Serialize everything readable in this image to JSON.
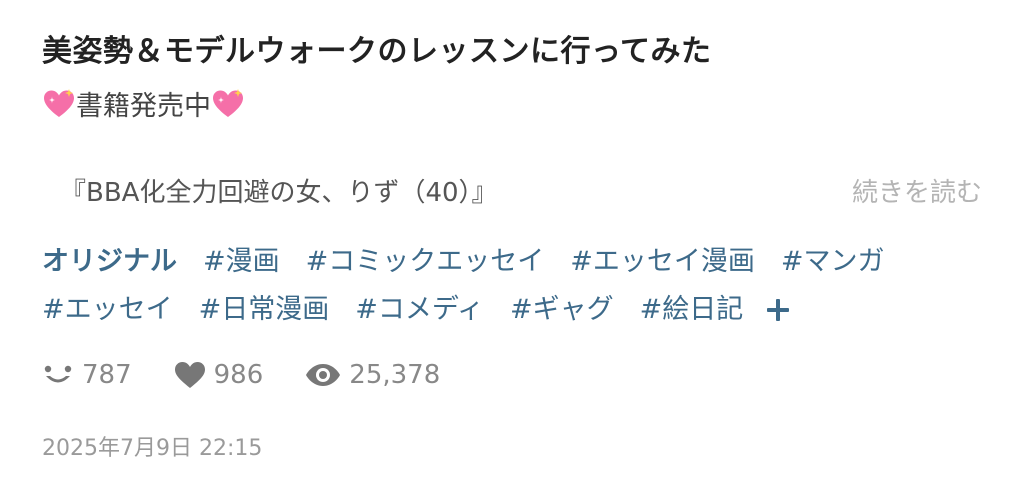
{
  "post": {
    "title": "美姿勢＆モデルウォークのレッスンに行ってみた",
    "subtitle": "書籍発売中",
    "subtitle_icon": "sparkling-heart-icon",
    "excerpt": "『BBA化全力回避の女、りず（40）』",
    "read_more_label": "続きを読む"
  },
  "tags": {
    "original_label": "オリジナル",
    "line1": [
      "#漫画",
      "#コミックエッセイ",
      "#エッセイ漫画",
      "#マンガ"
    ],
    "line2": [
      "#エッセイ",
      "#日常漫画",
      "#コメディ",
      "#ギャグ",
      "#絵日記"
    ],
    "more_icon": "plus-icon"
  },
  "stats": {
    "reactions": "787",
    "likes": "986",
    "views": "25,378"
  },
  "date": "2025年7月9日 22:15",
  "colors": {
    "tag": "#3d6a8a",
    "muted": "#888888",
    "heart_pink": "#f56fa8"
  }
}
